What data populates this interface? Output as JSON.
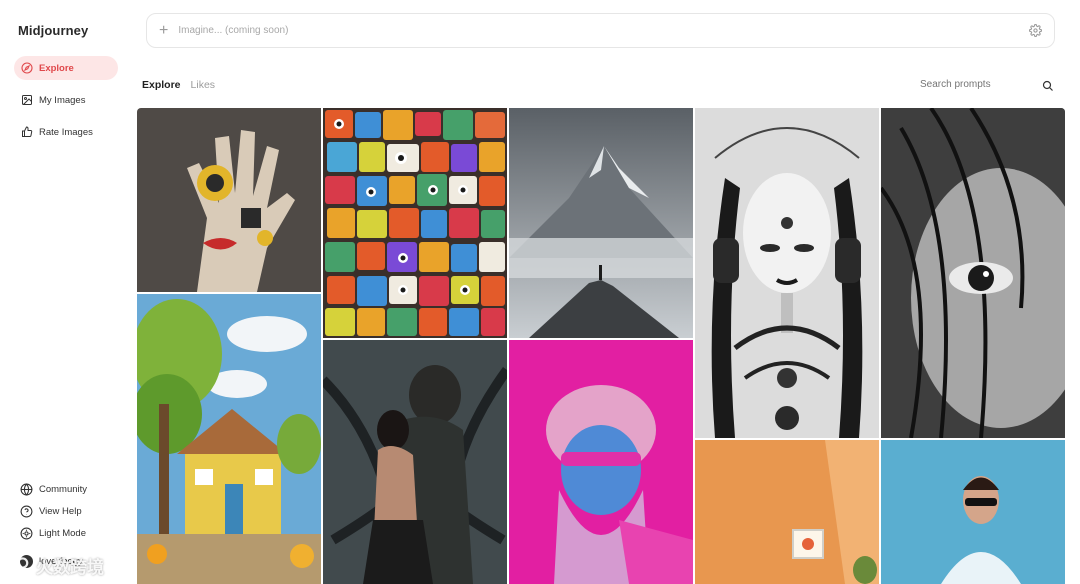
{
  "brand": "Midjourney",
  "sidebar": {
    "items": [
      {
        "label": "Explore",
        "icon": "compass-icon",
        "active": true
      },
      {
        "label": "My Images",
        "icon": "image-icon",
        "active": false
      },
      {
        "label": "Rate Images",
        "icon": "thumbs-up-icon",
        "active": false
      }
    ],
    "bottom_items": [
      {
        "label": "Community",
        "icon": "globe-icon"
      },
      {
        "label": "View Help",
        "icon": "help-icon"
      },
      {
        "label": "Light Mode",
        "icon": "sun-icon"
      }
    ],
    "user": {
      "name": "loverfoogy"
    }
  },
  "imagine": {
    "placeholder": "Imagine... (coming soon)"
  },
  "tabs": [
    {
      "label": "Explore",
      "active": true
    },
    {
      "label": "Likes",
      "active": false
    }
  ],
  "search": {
    "placeholder": "Search prompts"
  },
  "watermark": {
    "text": "火数跨境"
  },
  "colors": {
    "accent": "#e0484b",
    "accent_bg": "#fde6e6",
    "tile_hand": "#5a5450",
    "tile_faces": "#d8562a",
    "tile_mountain": "#7c8288",
    "tile_robot": "#d9d9d9",
    "tile_eye": "#6a6a6a",
    "tile_house": "#7ab3d9",
    "tile_couple": "#3f4648",
    "tile_pink": "#e324a8",
    "tile_orange_room": "#e79a5a",
    "tile_blue_woman": "#5aaed0"
  },
  "gallery": [
    {
      "name": "tile-hand-painting"
    },
    {
      "name": "tile-colorful-faces"
    },
    {
      "name": "tile-mountain-peak"
    },
    {
      "name": "tile-robot-woman"
    },
    {
      "name": "tile-bw-eye"
    },
    {
      "name": "tile-cartoon-house"
    },
    {
      "name": "tile-dark-couple"
    },
    {
      "name": "tile-pink-monkey"
    },
    {
      "name": "tile-orange-room"
    },
    {
      "name": "tile-blue-woman"
    },
    {
      "name": "tile-bottom-partial"
    }
  ]
}
